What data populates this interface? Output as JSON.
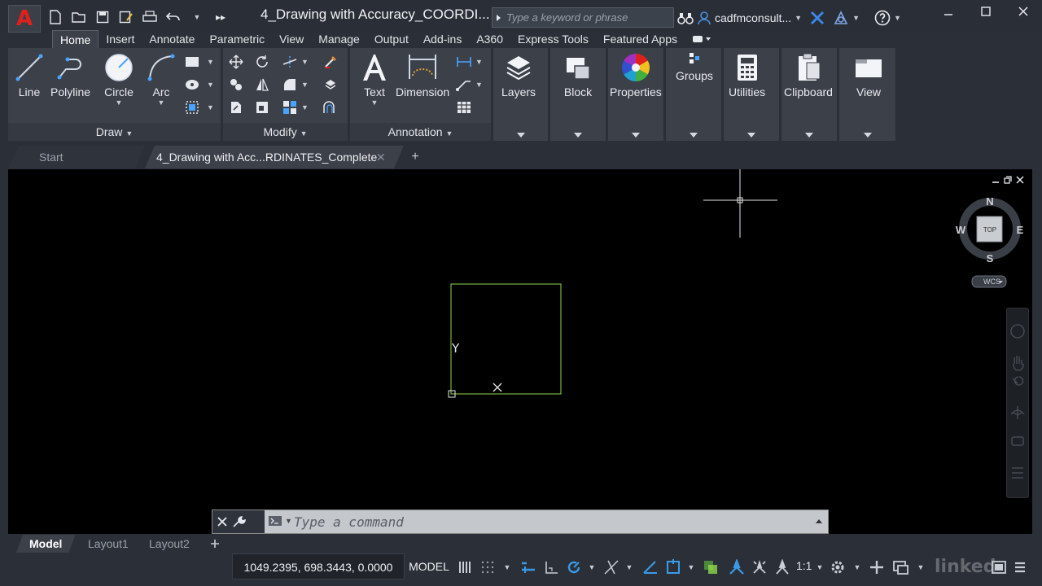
{
  "app": {
    "logo_letter": "A",
    "title": "4_Drawing with Accuracy_COORDI...",
    "search_placeholder": "Type a keyword or phrase",
    "user": "cadfmconsult...",
    "quick_access": [
      "new-icon",
      "open-icon",
      "save-icon",
      "save-as-icon",
      "plot-icon",
      "undo-icon",
      "undo-dropdown-icon",
      "more-icon"
    ]
  },
  "ribbon_tabs": [
    "Home",
    "Insert",
    "Annotate",
    "Parametric",
    "View",
    "Manage",
    "Output",
    "Add-ins",
    "A360",
    "Express Tools",
    "Featured Apps"
  ],
  "panels": {
    "draw": {
      "title": "Draw",
      "tools": [
        "Line",
        "Polyline",
        "Circle",
        "Arc"
      ]
    },
    "modify": {
      "title": "Modify"
    },
    "annotation": {
      "title": "Annotation",
      "tools": [
        "Text",
        "Dimension"
      ]
    },
    "groups": [
      "Layers",
      "Block",
      "Properties",
      "Groups",
      "Utilities",
      "Clipboard",
      "View"
    ]
  },
  "doc_tabs": {
    "start": "Start",
    "drawing": "4_Drawing with Acc...RDINATES_Complete",
    "close": "✕",
    "add": "+"
  },
  "viewcube": {
    "n": "N",
    "s": "S",
    "e": "E",
    "w": "W",
    "face": "TOP",
    "wcs": "WCS"
  },
  "ucs": {
    "y": "Y"
  },
  "command": {
    "placeholder": "Type a command"
  },
  "layout_tabs": [
    "Model",
    "Layout1",
    "Layout2"
  ],
  "status": {
    "coords": "1049.2395, 698.3443, 0.0000",
    "space": "MODEL",
    "scale": "1:1",
    "watermark": "linked"
  }
}
